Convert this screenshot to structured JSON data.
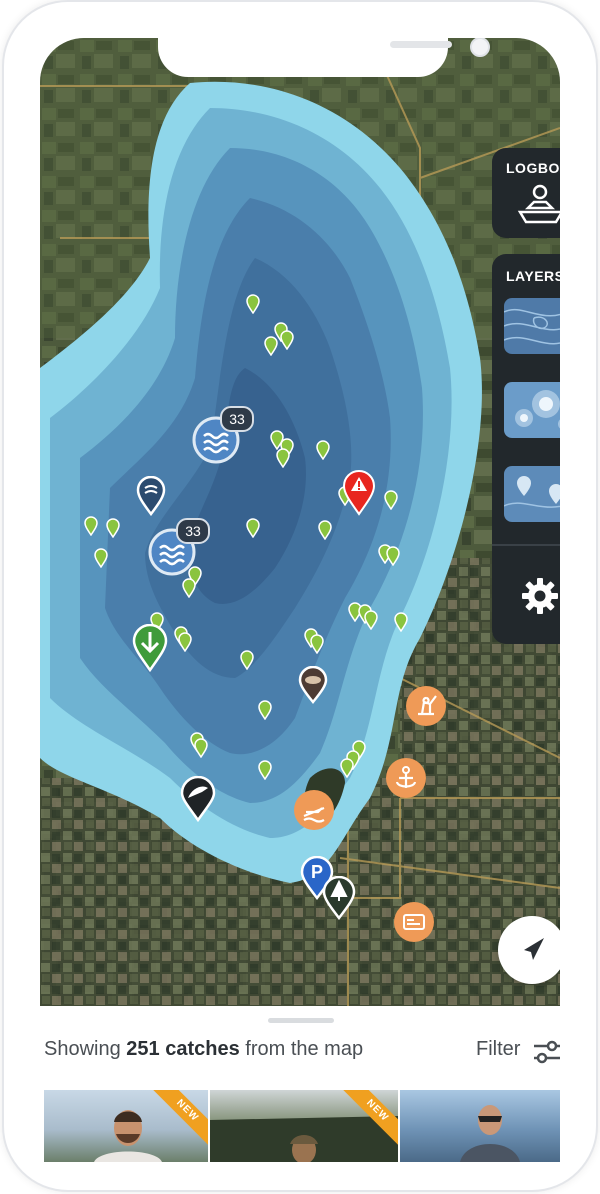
{
  "logbook": {
    "title": "LOGBOOK"
  },
  "layers": {
    "title": "LAYERS"
  },
  "clusters": [
    {
      "count": "33"
    },
    {
      "count": "33"
    }
  ],
  "summary": {
    "prefix": "Showing ",
    "count": "251 catches",
    "suffix": " from the map"
  },
  "filter": {
    "label": "Filter"
  },
  "photos": [
    {
      "badge": "NEW"
    },
    {
      "badge": "NEW"
    },
    {
      "badge": ""
    }
  ],
  "colors": {
    "accent_orange": "#ef9a57",
    "panel_dark": "#22282c",
    "lake_shallow": "#8fd6ea",
    "lake_deep": "#3d6c9a",
    "catch_pin": "#8ac43f",
    "warning_pin": "#e8261f",
    "parking_pin": "#2a66c8"
  }
}
